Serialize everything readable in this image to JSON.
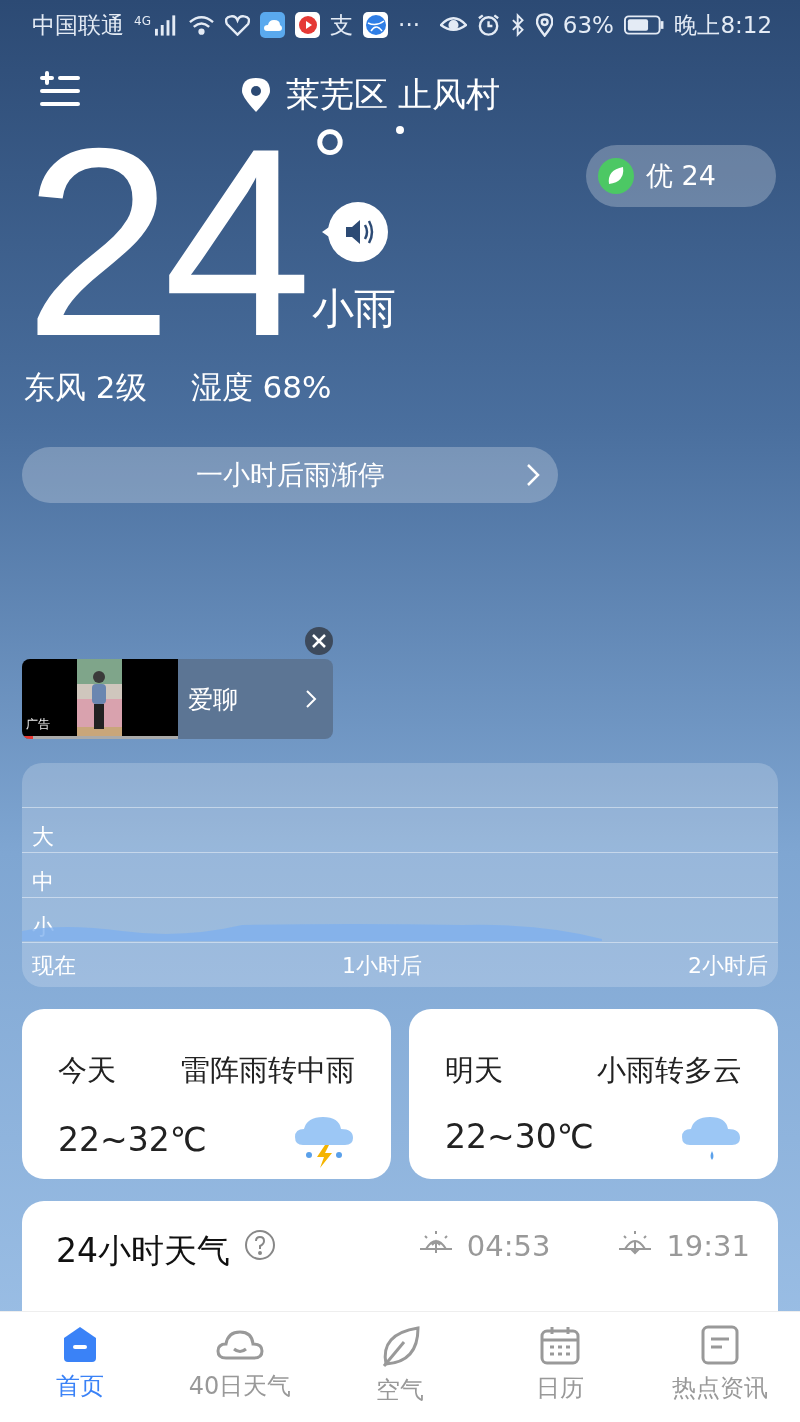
{
  "status_bar": {
    "carrier": "中国联通",
    "network": "4G",
    "app_glyph": "支",
    "more": "···",
    "battery_percent": "63%",
    "time": "晚上8:12"
  },
  "header": {
    "location": "莱芜区 止风村"
  },
  "current": {
    "temperature": "24",
    "degree": "°",
    "condition": "小雨",
    "wind": "东风 2级",
    "humidity": "湿度 68%",
    "aqi": "优 24"
  },
  "alert": {
    "text": "一小时后雨渐停"
  },
  "ad": {
    "badge": "广告",
    "title": "爱聊",
    "level": 0.07
  },
  "precipitation": {
    "levels": [
      "大",
      "中",
      "小"
    ],
    "times": [
      "现在",
      "1小时后",
      "2小时后"
    ]
  },
  "forecast": [
    {
      "day": "今天",
      "condition": "雷阵雨转中雨",
      "range": "22~32℃",
      "kind": "thunder"
    },
    {
      "day": "明天",
      "condition": "小雨转多云",
      "range": "22~30℃",
      "kind": "rain"
    }
  ],
  "hourly": {
    "title": "24小时天气",
    "sunrise": "04:53",
    "sunset": "19:31"
  },
  "tabs": [
    {
      "label": "首页",
      "selected": true,
      "kind": "home"
    },
    {
      "label": "40日天气",
      "selected": false,
      "kind": "cloud"
    },
    {
      "label": "空气",
      "selected": false,
      "kind": "leaf"
    },
    {
      "label": "日历",
      "selected": false,
      "kind": "calendar"
    },
    {
      "label": "热点资讯",
      "selected": false,
      "kind": "news"
    }
  ]
}
